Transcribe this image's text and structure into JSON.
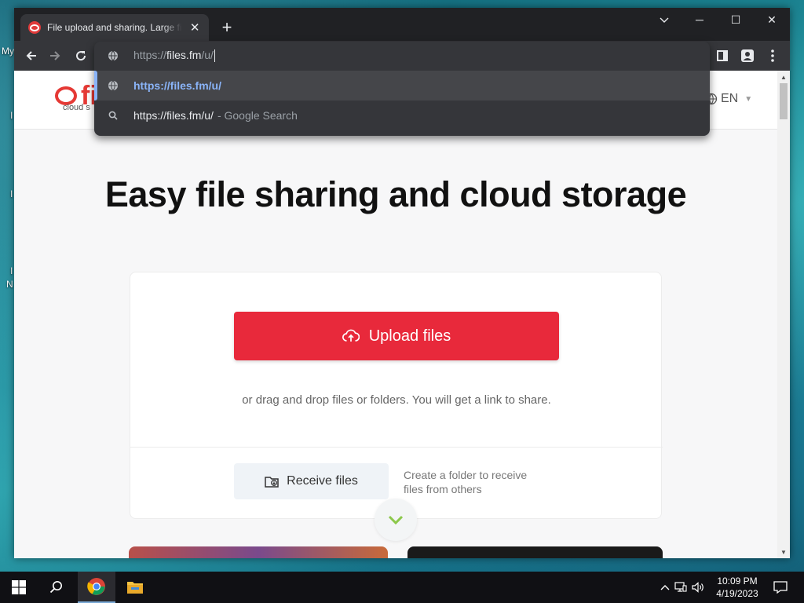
{
  "desktop": {
    "labels": [
      "My",
      "I",
      "I",
      "I",
      "N"
    ]
  },
  "browser": {
    "tab": {
      "title": "File upload and sharing. Large files",
      "close": "✕"
    },
    "new_tab": "+",
    "window_controls": {
      "minimize": "─",
      "maximize": "☐",
      "close": "✕"
    },
    "omnibox": {
      "prefix": "https://",
      "host": "files.fm",
      "path": "/u/",
      "suggestions": [
        {
          "url": "https://files.fm/u/",
          "selected": true,
          "icon": "globe-icon"
        },
        {
          "text": "https://files.fm/u/",
          "suffix": "- Google Search",
          "icon": "search-icon"
        }
      ]
    }
  },
  "site": {
    "logo_text": "fi",
    "logo_sub": "cloud s",
    "language": "EN",
    "hero_title": "Easy file sharing and cloud storage",
    "upload_button": "Upload files",
    "drag_hint": "or drag and drop files or folders. You will get a link to share.",
    "receive_button": "Receive files",
    "receive_note": "Create a folder to receive files from others",
    "accent_color": "#e8293b"
  },
  "taskbar": {
    "time": "10:09 PM",
    "date": "4/19/2023"
  }
}
